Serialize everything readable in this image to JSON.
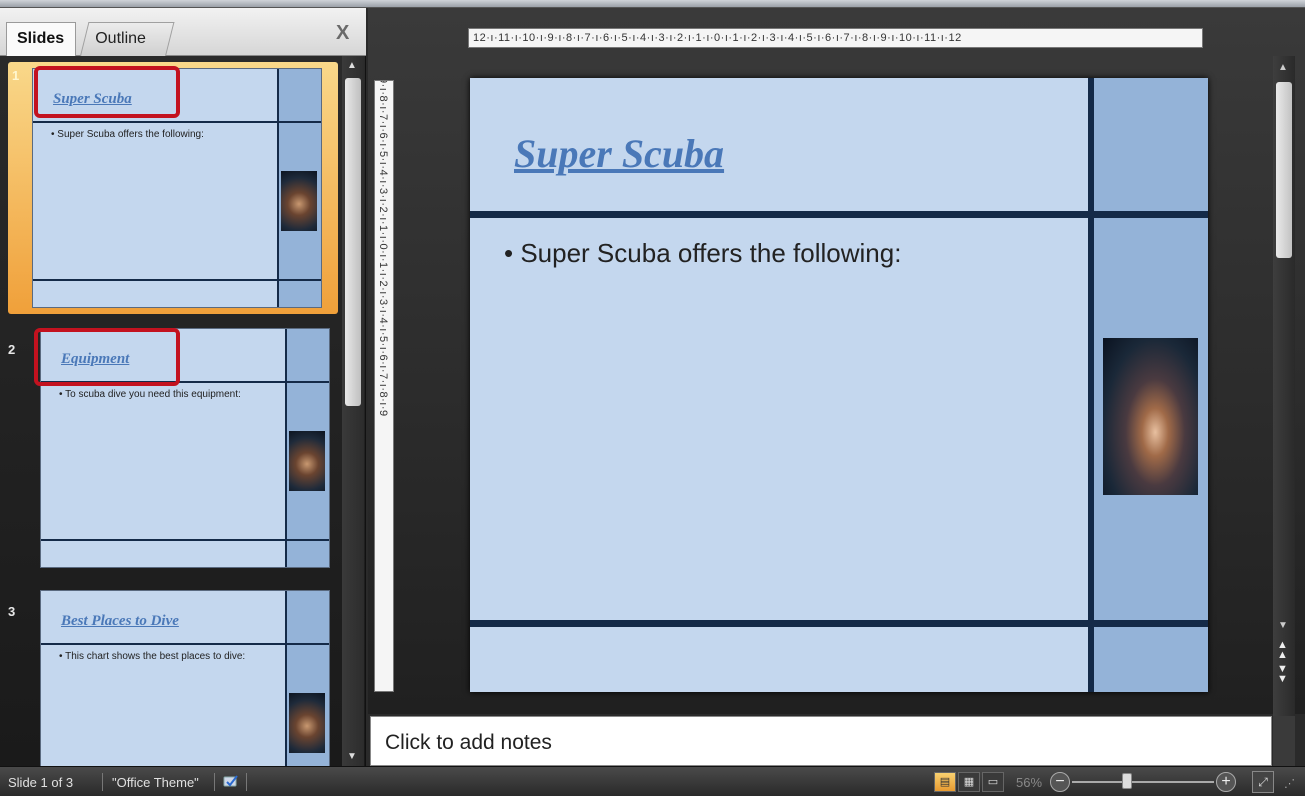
{
  "tabs": {
    "slides": "Slides",
    "outline": "Outline",
    "close": "X"
  },
  "thumbnails": [
    {
      "number": "1",
      "title": "Super Scuba",
      "bullet": "• Super Scuba offers the following:",
      "selected": true
    },
    {
      "number": "2",
      "title": "Equipment",
      "bullet": "• To scuba dive you need this equipment:",
      "selected": false
    },
    {
      "number": "3",
      "title": "Best Places to Dive",
      "bullet": "• This chart shows the best places to dive:",
      "selected": false
    }
  ],
  "ruler": {
    "horizontal": "12·ı·11·ı·10·ı·9·ı·8·ı·7·ı·6·ı·5·ı·4·ı·3·ı·2·ı·1·ı·0·ı·1·ı·2·ı·3·ı·4·ı·5·ı·6·ı·7·ı·8·ı·9·ı·10·ı·11·ı·12",
    "vertical": "9·ı·8·ı·7·ı·6·ı·5·ı·4·ı·3·ı·2·ı·1·ı·0·ı·1·ı·2·ı·3·ı·4·ı·5·ı·6·ı·7·ı·8·ı·9"
  },
  "slide": {
    "title": "Super Scuba",
    "bullet": "• Super Scuba offers the following:"
  },
  "notes": {
    "placeholder": "Click to add notes"
  },
  "status": {
    "slide_indicator": "Slide 1 of 3",
    "theme": "\"Office Theme\"",
    "zoom": "56%"
  },
  "colors": {
    "accent_red": "#c3121f",
    "slide_bg": "#c4d7ee",
    "title_blue": "#4a78b8",
    "selection_orange": "#f0a03a"
  }
}
